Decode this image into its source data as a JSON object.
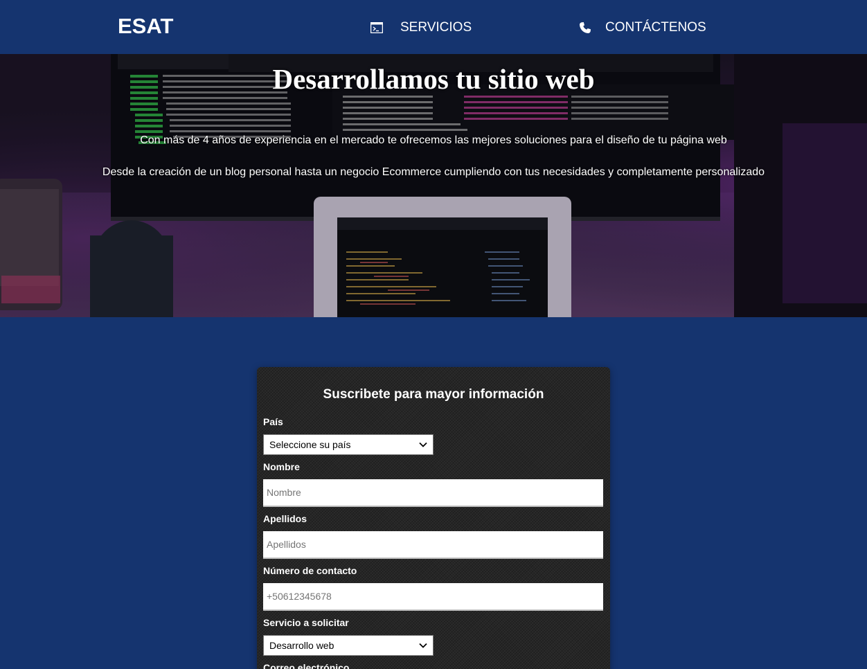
{
  "nav": {
    "brand": "ESAT",
    "services_label": "SERVICIOS",
    "contact_label": "CONTÁCTENOS"
  },
  "hero": {
    "title": "Desarrollamos tu sitio web",
    "line1": "Con más de 4 años de experiencia en el mercado te ofrecemos las mejores soluciones para el diseño de tu página web",
    "line2": "Desde la creación de un blog personal hasta un negocio Ecommerce cumpliendo con tus necesidades y completamente personalizado"
  },
  "form": {
    "title": "Suscribete para mayor información",
    "country_label": "País",
    "country_value": "Seleccione su país",
    "name_label": "Nombre",
    "name_placeholder": "Nombre",
    "lastname_label": "Apellidos",
    "lastname_placeholder": "Apellidos",
    "phone_label": "Número de contacto",
    "phone_placeholder": "+50612345678",
    "service_label": "Servicio a solicitar",
    "service_value": "Desarrollo web",
    "email_label": "Correo electrónico"
  },
  "colors": {
    "primary_blue": "#15346f",
    "card_dark": "#262626"
  },
  "icons": {
    "services": "terminal-icon",
    "contact": "phone-icon"
  }
}
